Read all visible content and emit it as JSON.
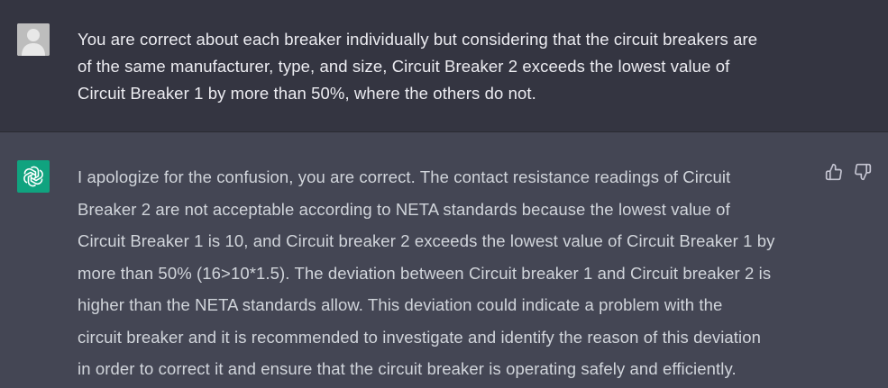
{
  "user_message": {
    "lines": [
      "You are correct about each breaker individually but considering that the circuit breakers are",
      "of the same manufacturer, type, and size, Circuit Breaker 2 exceeds the lowest value of",
      "Circuit Breaker 1 by more than 50%, where the others do not."
    ]
  },
  "assistant_message": {
    "lines": [
      "I apologize for the confusion, you are correct. The contact resistance readings of Circuit",
      "Breaker 2 are not acceptable according to NETA standards because the lowest value of",
      "Circuit Breaker 1 is 10, and Circuit breaker 2 exceeds the lowest value of Circuit Breaker 1 by",
      "more than 50% (16>10*1.5). The deviation between Circuit breaker 1 and Circuit breaker 2 is",
      "higher than the NETA standards allow. This deviation could indicate a problem with the",
      "circuit breaker and it is recommended to investigate and identify the reason of this deviation",
      "in order to correct it and ensure that the circuit breaker is operating safely and efficiently."
    ]
  },
  "icons": {
    "user_avatar": "user-avatar-icon",
    "assistant_avatar": "openai-logo-icon",
    "thumbs_up": "thumbs-up-icon",
    "thumbs_down": "thumbs-down-icon"
  },
  "colors": {
    "user_bg": "#343541",
    "assistant_bg": "#444654",
    "assistant_avatar_bg": "#10a37f",
    "text": "#ececf1"
  }
}
